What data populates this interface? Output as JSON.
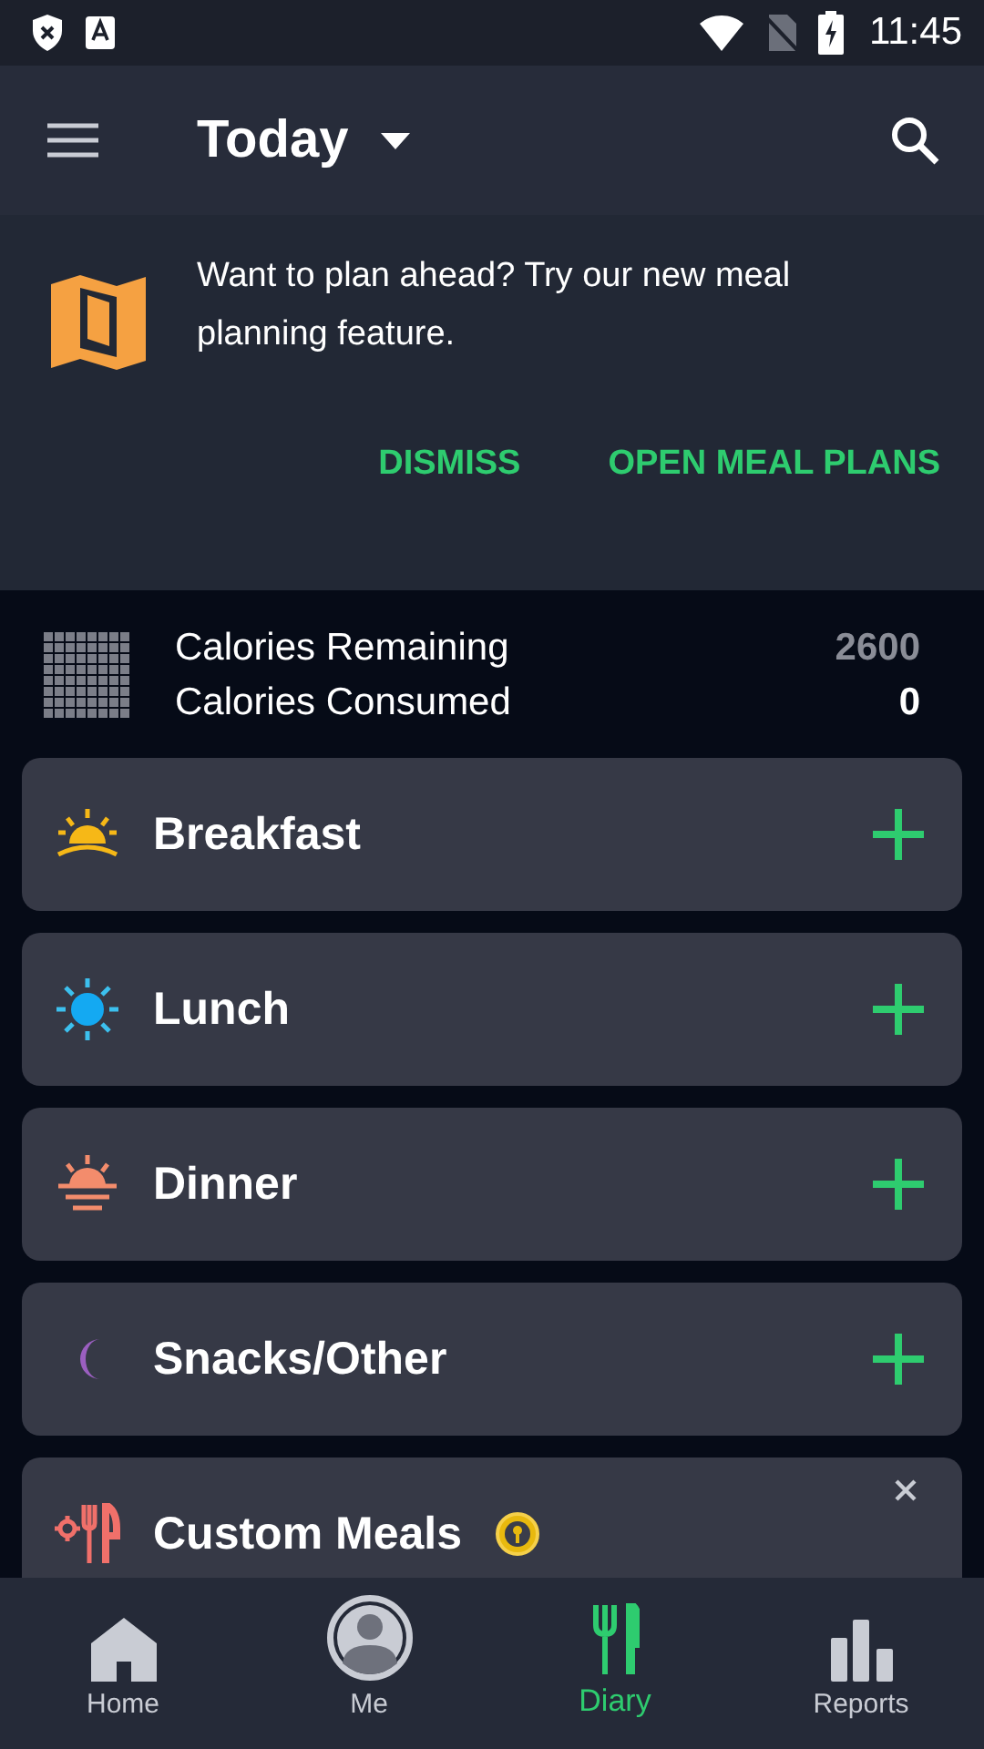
{
  "status_bar": {
    "time": "11:45"
  },
  "app_bar": {
    "title": "Today"
  },
  "banner": {
    "message": "Want to plan ahead? Try our new meal planning feature.",
    "actions": [
      "DISMISS",
      "OPEN MEAL PLANS"
    ]
  },
  "calories": [
    {
      "label": "Calories Remaining",
      "value": "2600",
      "kind": "remaining"
    },
    {
      "label": "Calories Consumed",
      "value": "0",
      "kind": "consumed"
    }
  ],
  "meals": [
    {
      "name": "Breakfast",
      "kind": "sunrise"
    },
    {
      "name": "Lunch",
      "kind": "sun"
    },
    {
      "name": "Dinner",
      "kind": "sunset"
    },
    {
      "name": "Snacks/Other",
      "kind": "moon"
    }
  ],
  "custom_meals": {
    "title": "Custom Meals",
    "premium": true
  },
  "bottom_nav": [
    {
      "label": "Home",
      "kind": "home",
      "selected": false
    },
    {
      "label": "Me",
      "kind": "me",
      "selected": false
    },
    {
      "label": "Diary",
      "kind": "diary",
      "selected": true
    },
    {
      "label": "Reports",
      "kind": "reports",
      "selected": false
    }
  ]
}
